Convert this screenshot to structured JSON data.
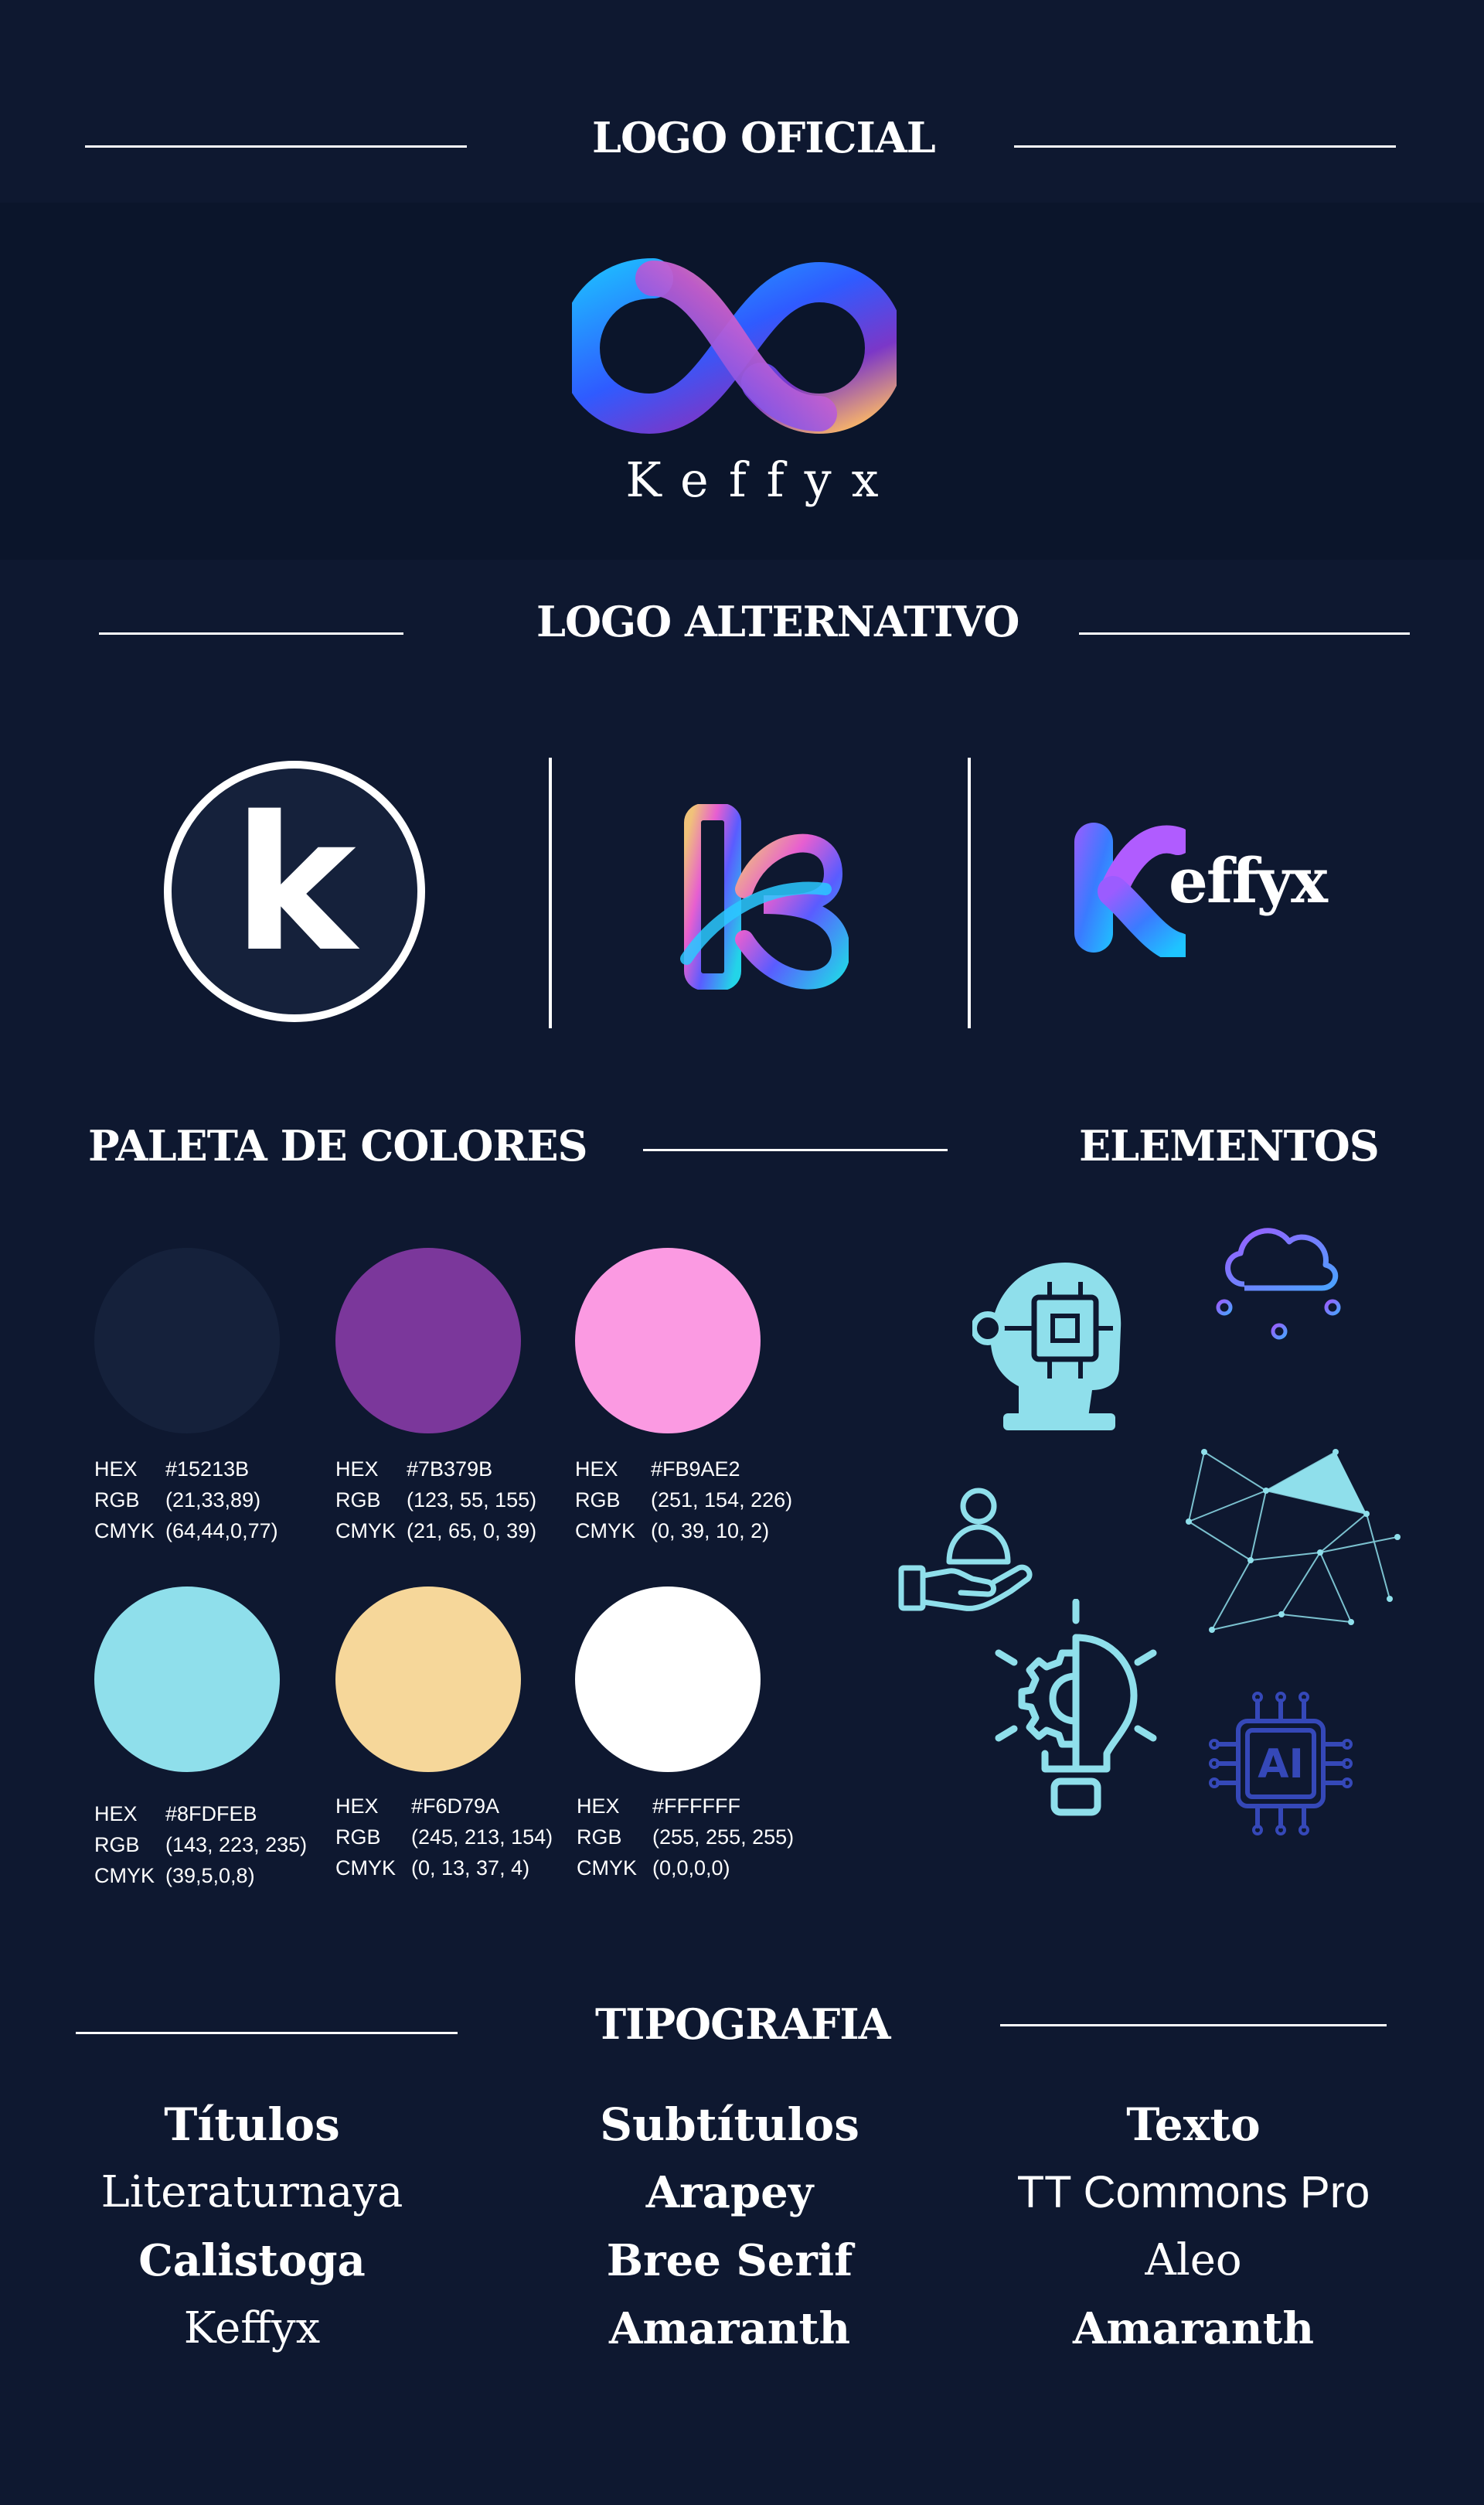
{
  "sections": {
    "logo_oficial": "LOGO OFICIAL",
    "logo_alternativo": "LOGO ALTERNATIVO",
    "paleta": "PALETA DE COLORES",
    "elementos": "ELEMENTOS",
    "tipografia": "TIPOGRAFIA"
  },
  "brand": {
    "wordmark": "Keffyx",
    "monogram_letter": "k",
    "alt_wordmark_rest": "effyx"
  },
  "palette": [
    {
      "color": "#15213B",
      "hex_label": "HEX",
      "hex": "#15213B",
      "rgb_label": "RGB",
      "rgb": "(21,33,89)",
      "cmyk_label": "CMYK",
      "cmyk": "(64,44,0,77)"
    },
    {
      "color": "#7B379B",
      "hex_label": "HEX",
      "hex": "#7B379B",
      "rgb_label": "RGB",
      "rgb": "(123, 55, 155)",
      "cmyk_label": "CMYK",
      "cmyk": "(21, 65, 0, 39)"
    },
    {
      "color": "#FB9AE2",
      "hex_label": "HEX",
      "hex": "#FB9AE2",
      "rgb_label": "RGB",
      "rgb": "(251, 154, 226)",
      "cmyk_label": "CMYK",
      "cmyk": "(0, 39, 10, 2)"
    },
    {
      "color": "#8FDFEB",
      "hex_label": "HEX",
      "hex": "#8FDFEB",
      "rgb_label": "RGB",
      "rgb": "(143, 223, 235)",
      "cmyk_label": "CMYK",
      "cmyk": "(39,5,0,8)"
    },
    {
      "color": "#F6D79A",
      "hex_label": "HEX",
      "hex": "#F6D79A",
      "rgb_label": "RGB",
      "rgb": "(245, 213, 154)",
      "cmyk_label": "CMYK",
      "cmyk": "(0, 13, 37, 4)"
    },
    {
      "color": "#FFFFFF",
      "hex_label": "HEX",
      "hex": "#FFFFFF",
      "rgb_label": "RGB",
      "rgb": "(255, 255, 255)",
      "cmyk_label": "CMYK",
      "cmyk": "(0,0,0,0)"
    }
  ],
  "elements": {
    "ai_chip_label": "AI",
    "icons": [
      "head-circuit-icon",
      "cloud-network-icon",
      "low-poly-network-icon",
      "hand-person-icon",
      "gear-lightbulb-icon",
      "ai-chip-icon"
    ]
  },
  "typography": {
    "titulos": {
      "heading": "Títulos",
      "items": [
        "Literaturnaya",
        "Calistoga",
        "Keffyx"
      ]
    },
    "subtitulos": {
      "heading": "Subtítulos",
      "items": [
        "Arapey",
        "Bree Serif",
        "Amaranth"
      ]
    },
    "texto": {
      "heading": "Texto",
      "items": [
        "TT Commons Pro",
        "Aleo",
        "Amaranth"
      ]
    }
  },
  "colors": {
    "background": "#0e1830",
    "band": "#0b152b",
    "accent_cyan": "#8fdfeb",
    "accent_blue": "#2f6bff",
    "accent_purple": "#7b379b"
  }
}
